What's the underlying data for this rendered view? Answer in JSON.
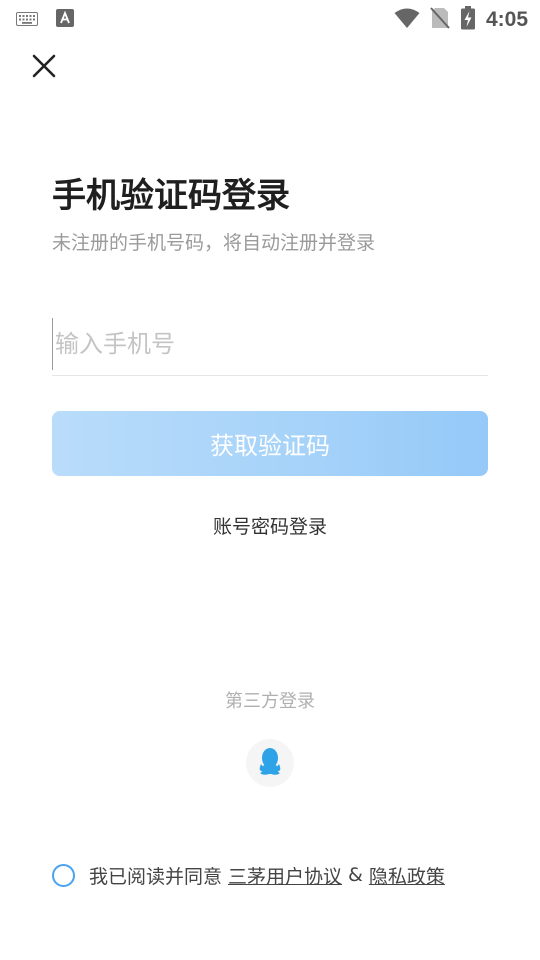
{
  "status_bar": {
    "time": "4:05",
    "icons": [
      "keyboard-icon",
      "text-a-icon",
      "wifi-icon",
      "no-sim-icon",
      "battery-charging-icon"
    ]
  },
  "header": {
    "close_icon": "close-icon"
  },
  "main": {
    "title": "手机验证码登录",
    "subtitle": "未注册的手机号码，将自动注册并登录",
    "phone_input": {
      "value": "",
      "placeholder": "输入手机号"
    },
    "get_code_label": "获取验证码",
    "password_login_label": "账号密码登录"
  },
  "third_party": {
    "title": "第三方登录",
    "providers": [
      "qq-icon"
    ]
  },
  "agreement": {
    "prefix": "我已阅读并同意",
    "user_agreement": "三茅用户协议",
    "separator": "&",
    "privacy_policy": "隐私政策",
    "checked": false
  },
  "colors": {
    "accent": "#4aa3f0",
    "button_gradient_start": "#b9dcfa",
    "button_gradient_end": "#95c9f8",
    "subtitle_gray": "#9a9a9a"
  }
}
